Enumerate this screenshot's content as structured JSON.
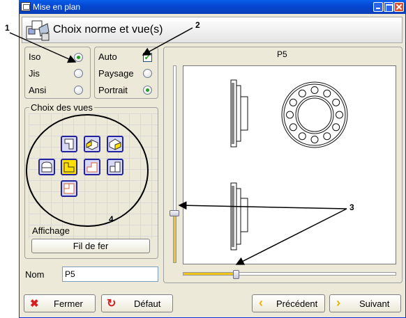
{
  "window": {
    "title": "Mise en plan"
  },
  "header": {
    "title": "Choix norme et vue(s)"
  },
  "standards": {
    "items": [
      {
        "label": "Iso",
        "selected": true
      },
      {
        "label": "Jis",
        "selected": false
      },
      {
        "label": "Ansi",
        "selected": false
      }
    ]
  },
  "orientation": {
    "auto_label": "Auto",
    "auto_checked": true,
    "items": [
      {
        "label": "Paysage",
        "selected": false
      },
      {
        "label": "Portrait",
        "selected": true
      }
    ]
  },
  "views": {
    "group_label": "Choix des vues",
    "buttons": [
      "view-front-icon",
      "view-iso-left-icon",
      "view-iso-right-icon",
      "view-left-icon",
      "view-top-icon",
      "view-section-icon",
      "view-right-icon",
      "view-bottom-icon"
    ],
    "selected": "view-top-icon",
    "display_label": "Affichage",
    "display_button": "Fil de fer"
  },
  "name": {
    "label": "Nom",
    "value": "P5"
  },
  "preview": {
    "title": "P5",
    "vertical_slider_level": 0.24,
    "horizontal_slider_level": 0.25
  },
  "callouts": [
    "1",
    "2",
    "3",
    "4"
  ],
  "footer": {
    "close": "Fermer",
    "default": "Défaut",
    "previous": "Précédent",
    "next": "Suivant"
  },
  "colors": {
    "title_bar": "#0a5ee8",
    "accent_green": "#21a121",
    "slider_fill": "#f0c419",
    "view_button_fill": "#d7d7f6",
    "view_button_border": "#22229a",
    "selected_view_fill": "#ffe000"
  }
}
